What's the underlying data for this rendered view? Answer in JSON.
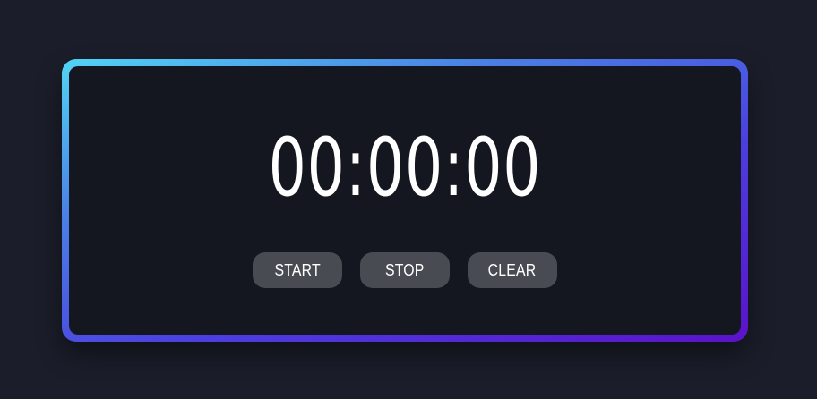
{
  "timer": {
    "display": "00:00:00"
  },
  "controls": {
    "start_label": "START",
    "stop_label": "STOP",
    "clear_label": "CLEAR"
  },
  "colors": {
    "background": "#1b1e2a",
    "panel": "#151720",
    "button": "#494b53",
    "gradient_start": "#52d4f5",
    "gradient_end": "#5b12c9",
    "text": "#ffffff"
  }
}
